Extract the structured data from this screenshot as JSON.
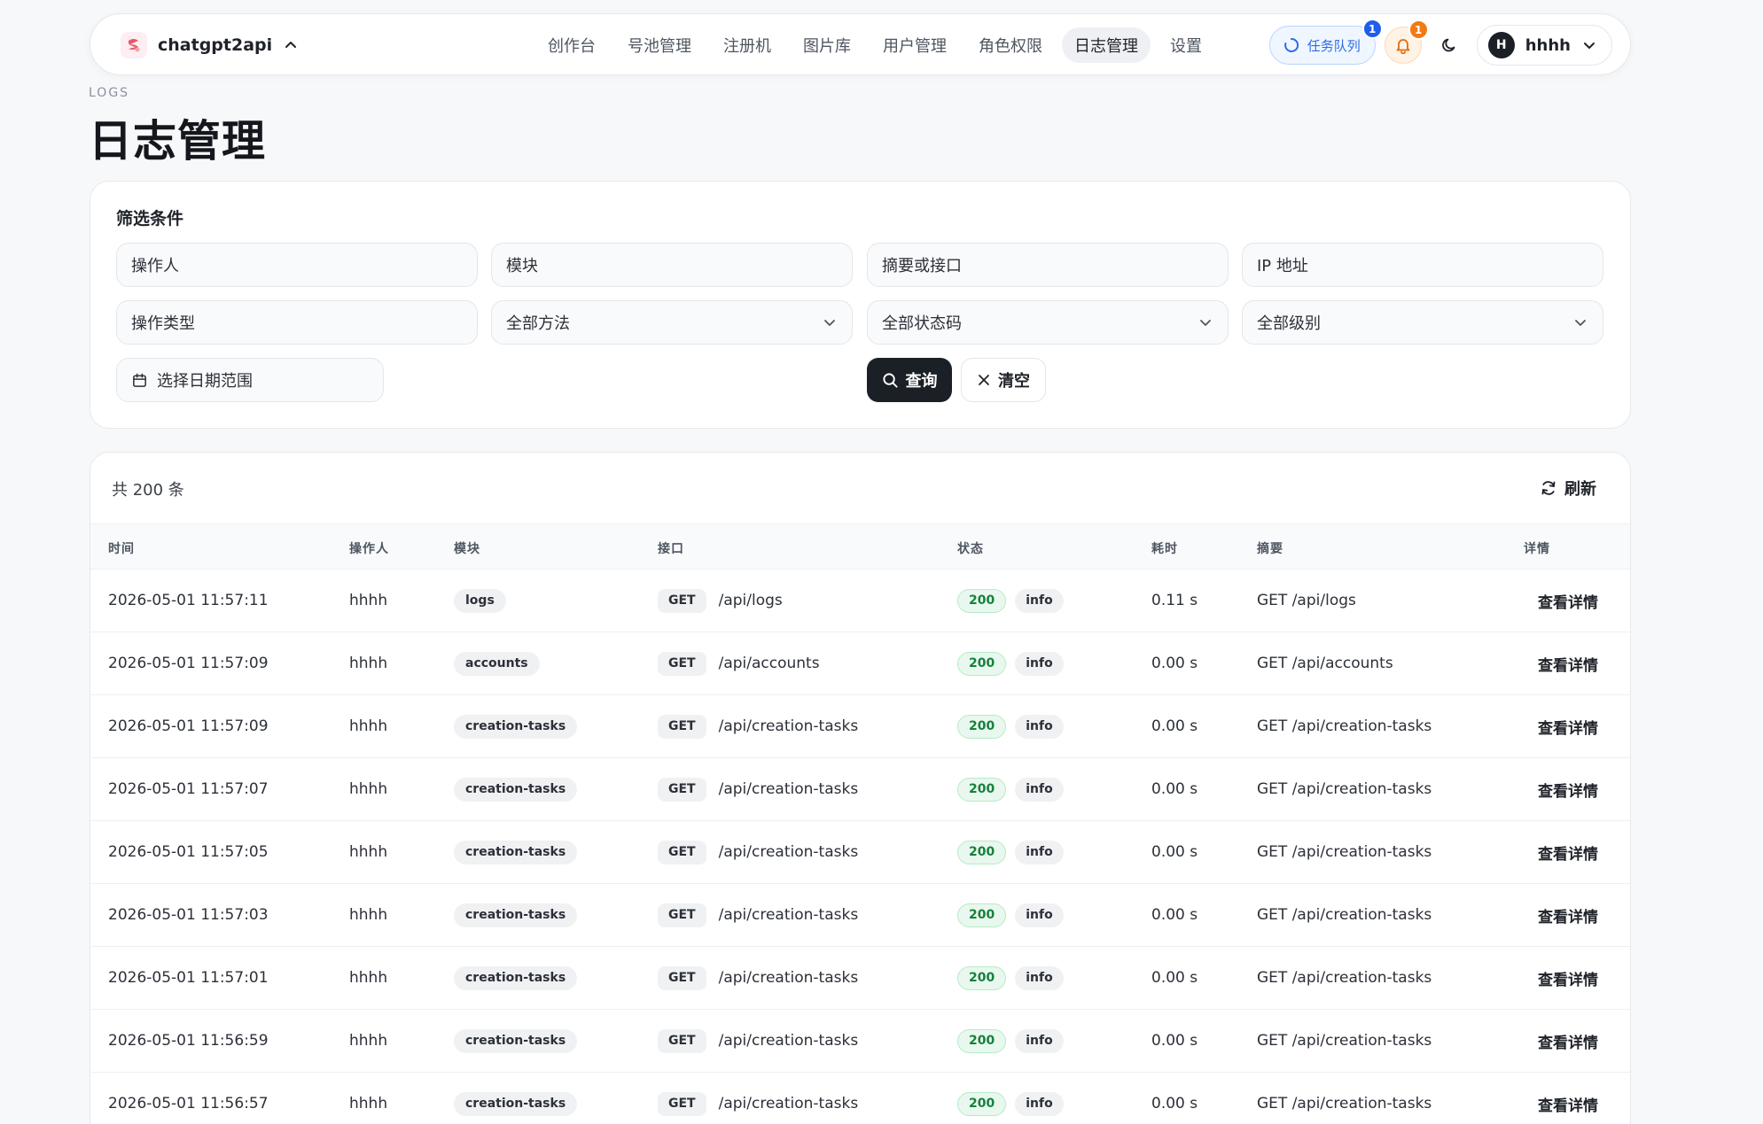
{
  "brand": {
    "name": "chatgpt2api"
  },
  "nav": [
    {
      "label": "创作台",
      "active": false
    },
    {
      "label": "号池管理",
      "active": false
    },
    {
      "label": "注册机",
      "active": false
    },
    {
      "label": "图片库",
      "active": false
    },
    {
      "label": "用户管理",
      "active": false
    },
    {
      "label": "角色权限",
      "active": false
    },
    {
      "label": "日志管理",
      "active": true
    },
    {
      "label": "设置",
      "active": false
    }
  ],
  "tools": {
    "queue_label": "任务队列",
    "queue_badge": "1",
    "notify_badge": "1",
    "user_initial": "H",
    "user_name": "hhhh"
  },
  "header": {
    "eyebrow": "LOGS",
    "title": "日志管理"
  },
  "filters": {
    "title": "筛选条件",
    "operator_placeholder": "操作人",
    "module_placeholder": "模块",
    "summary_placeholder": "摘要或接口",
    "ip_placeholder": "IP 地址",
    "action_type_placeholder": "操作类型",
    "method_value": "全部方法",
    "status_value": "全部状态码",
    "level_value": "全部级别",
    "date_range_placeholder": "选择日期范围",
    "query_label": "查询",
    "clear_label": "清空"
  },
  "table": {
    "total": "共 200 条",
    "refresh_label": "刷新",
    "columns": [
      "时间",
      "操作人",
      "模块",
      "接口",
      "状态",
      "耗时",
      "摘要",
      "详情"
    ],
    "detail_label": "查看详情",
    "rows": [
      {
        "time": "2026-05-01 11:57:11",
        "operator": "hhhh",
        "module": "logs",
        "method": "GET",
        "path": "/api/logs",
        "status": "200",
        "level": "info",
        "duration": "0.11 s",
        "summary": "GET /api/logs"
      },
      {
        "time": "2026-05-01 11:57:09",
        "operator": "hhhh",
        "module": "accounts",
        "method": "GET",
        "path": "/api/accounts",
        "status": "200",
        "level": "info",
        "duration": "0.00 s",
        "summary": "GET /api/accounts"
      },
      {
        "time": "2026-05-01 11:57:09",
        "operator": "hhhh",
        "module": "creation-tasks",
        "method": "GET",
        "path": "/api/creation-tasks",
        "status": "200",
        "level": "info",
        "duration": "0.00 s",
        "summary": "GET /api/creation-tasks"
      },
      {
        "time": "2026-05-01 11:57:07",
        "operator": "hhhh",
        "module": "creation-tasks",
        "method": "GET",
        "path": "/api/creation-tasks",
        "status": "200",
        "level": "info",
        "duration": "0.00 s",
        "summary": "GET /api/creation-tasks"
      },
      {
        "time": "2026-05-01 11:57:05",
        "operator": "hhhh",
        "module": "creation-tasks",
        "method": "GET",
        "path": "/api/creation-tasks",
        "status": "200",
        "level": "info",
        "duration": "0.00 s",
        "summary": "GET /api/creation-tasks"
      },
      {
        "time": "2026-05-01 11:57:03",
        "operator": "hhhh",
        "module": "creation-tasks",
        "method": "GET",
        "path": "/api/creation-tasks",
        "status": "200",
        "level": "info",
        "duration": "0.00 s",
        "summary": "GET /api/creation-tasks"
      },
      {
        "time": "2026-05-01 11:57:01",
        "operator": "hhhh",
        "module": "creation-tasks",
        "method": "GET",
        "path": "/api/creation-tasks",
        "status": "200",
        "level": "info",
        "duration": "0.00 s",
        "summary": "GET /api/creation-tasks"
      },
      {
        "time": "2026-05-01 11:56:59",
        "operator": "hhhh",
        "module": "creation-tasks",
        "method": "GET",
        "path": "/api/creation-tasks",
        "status": "200",
        "level": "info",
        "duration": "0.00 s",
        "summary": "GET /api/creation-tasks"
      },
      {
        "time": "2026-05-01 11:56:57",
        "operator": "hhhh",
        "module": "creation-tasks",
        "method": "GET",
        "path": "/api/creation-tasks",
        "status": "200",
        "level": "info",
        "duration": "0.00 s",
        "summary": "GET /api/creation-tasks"
      }
    ]
  },
  "colors": {
    "accent": "#1b1f26",
    "queue_blue": "#2b6de8",
    "notify_orange": "#f07a14",
    "status_green": "#16803c"
  },
  "icons": {
    "brand": "brand-logo-icon",
    "caret": "chevron-up-icon",
    "queue": "spinner-icon",
    "bell": "bell-icon",
    "theme": "moon-icon",
    "user_menu": "chevron-down-icon",
    "date": "calendar-icon",
    "query": "search-icon",
    "clear": "close-icon",
    "refresh": "refresh-icon"
  }
}
